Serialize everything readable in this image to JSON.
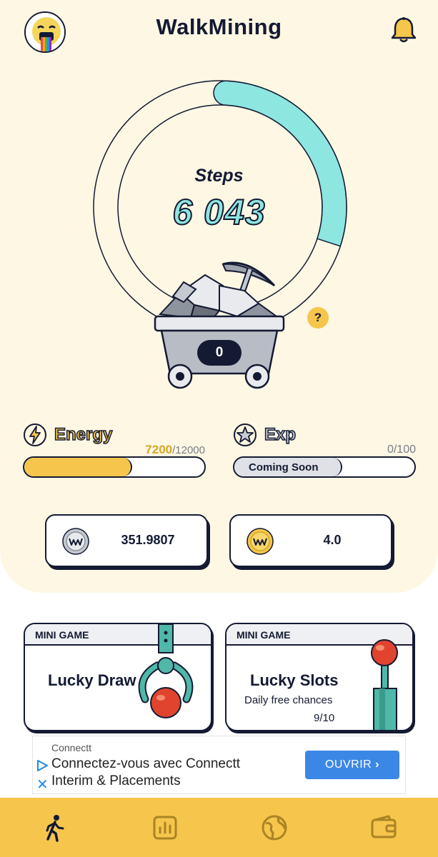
{
  "header": {
    "title": "WalkMining"
  },
  "steps": {
    "label": "Steps",
    "value": "6 043",
    "progress": 0.3,
    "help": "?"
  },
  "cart": {
    "count": "0"
  },
  "energy": {
    "label": "Energy",
    "current": "7200",
    "max": "/12000",
    "progress": 0.6
  },
  "exp": {
    "label": "Exp",
    "count": "0/100",
    "bar_text": "Coming Soon",
    "progress": 0.6
  },
  "wallets": {
    "silver": {
      "value": "351.9807"
    },
    "gold": {
      "value": "4.0"
    }
  },
  "mini_games": [
    {
      "header": "MINI GAME",
      "title": "Lucky Draw"
    },
    {
      "header": "MINI GAME",
      "title": "Lucky Slots",
      "subtitle": "Daily free chances",
      "count": "9/10"
    }
  ],
  "ad": {
    "brand": "Connectt",
    "line1": "Connectez-vous avec Connectt",
    "line2": "Interim & Placements",
    "button": "OUVRIR"
  },
  "tabs": [
    {
      "icon": "walk-icon",
      "active": true
    },
    {
      "icon": "stats-icon",
      "active": false
    },
    {
      "icon": "globe-icon",
      "active": false
    },
    {
      "icon": "wallet-icon",
      "active": false
    }
  ],
  "colors": {
    "background": "#fdf7e3",
    "accent_yellow": "#f5c64b",
    "accent_teal": "#8de6e0",
    "ink": "#141a33",
    "ad_button": "#3b87e6"
  }
}
